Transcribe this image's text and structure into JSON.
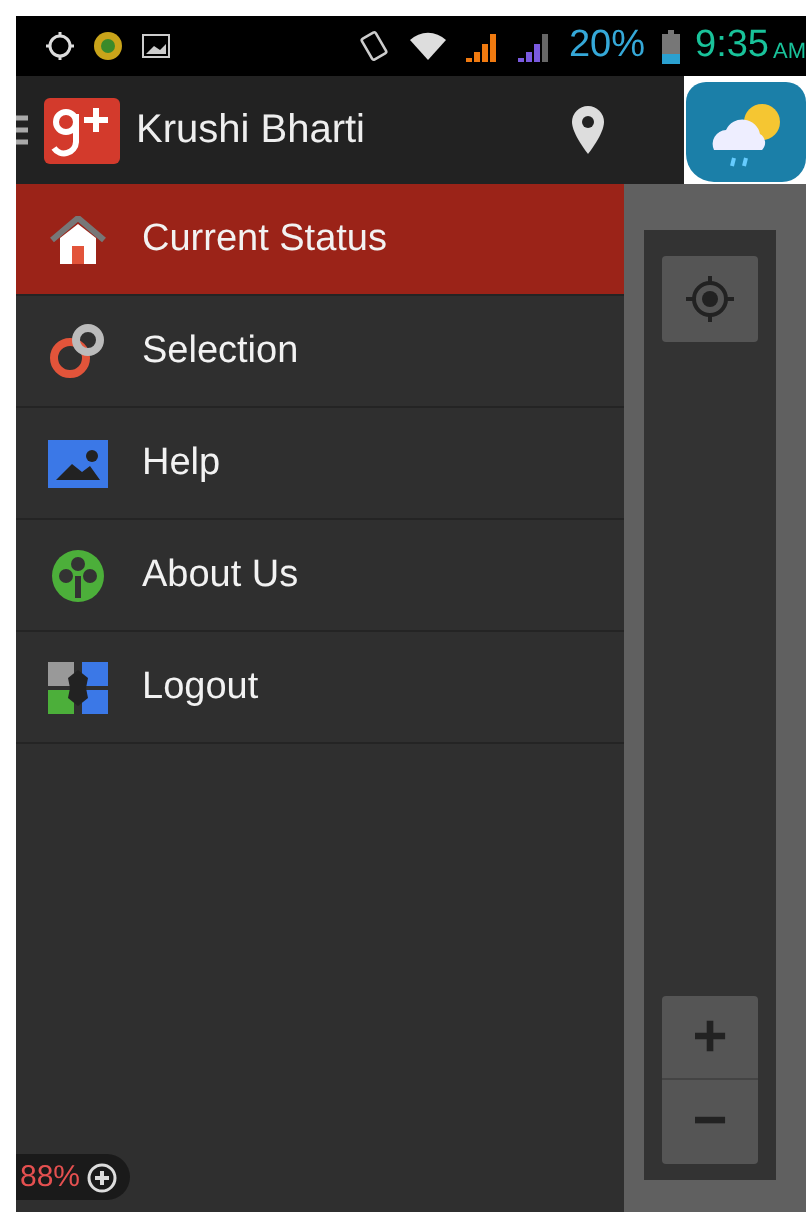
{
  "status_bar": {
    "battery": "20%",
    "time": "9:35",
    "meridiem": "AM"
  },
  "app_bar": {
    "title": "Krushi Bharti"
  },
  "drawer": {
    "items": [
      {
        "label": "Current Status",
        "kind": "home",
        "selected": true
      },
      {
        "label": "Selection",
        "kind": "selection",
        "selected": false
      },
      {
        "label": "Help",
        "kind": "help",
        "selected": false
      },
      {
        "label": "About Us",
        "kind": "about",
        "selected": false
      },
      {
        "label": "Logout",
        "kind": "logout",
        "selected": false
      }
    ]
  },
  "map": {
    "zoom_in": "+",
    "zoom_out": "−"
  },
  "battery_badge": {
    "text": "88%"
  }
}
